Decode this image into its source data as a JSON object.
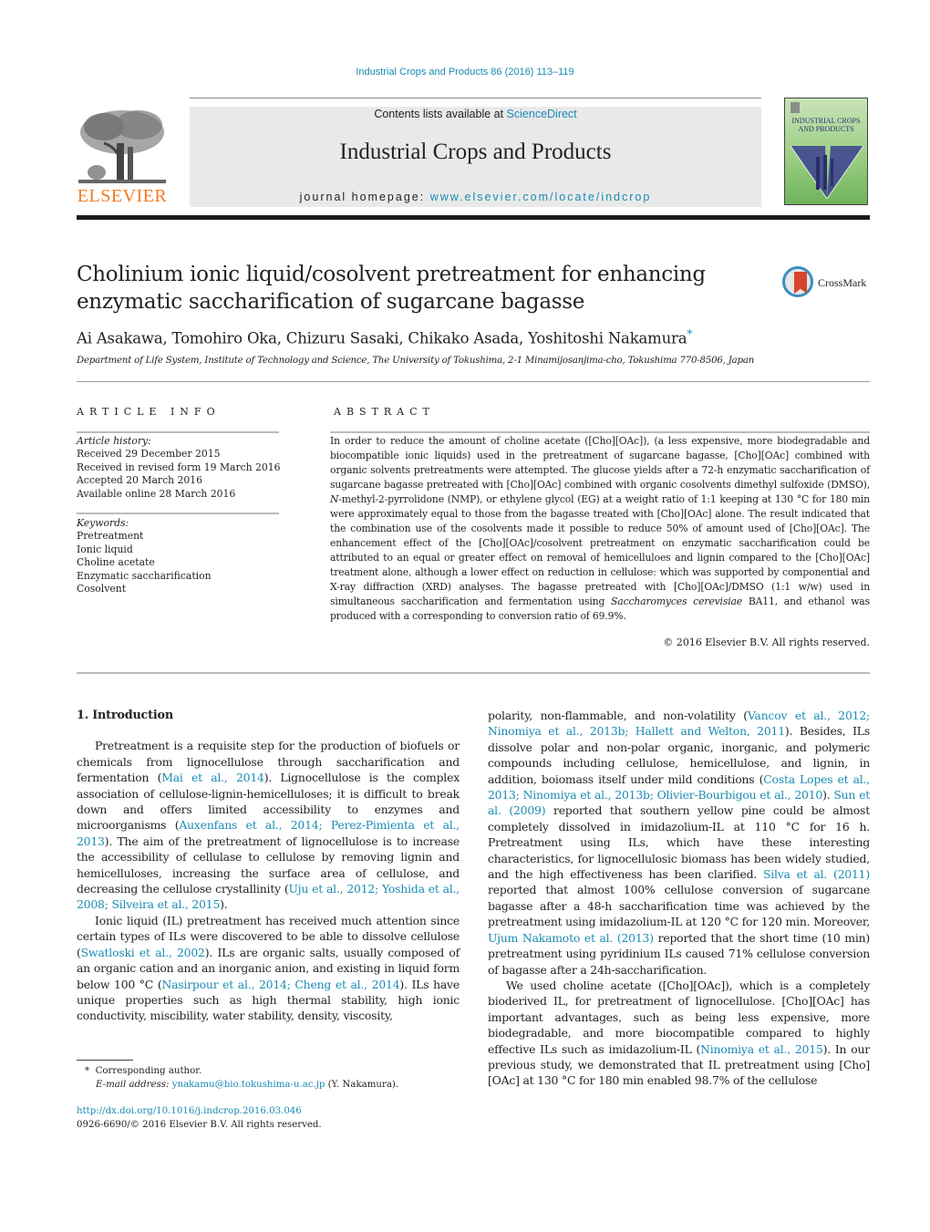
{
  "header": {
    "citation": "Industrial Crops and Products 86 (2016) 113–119",
    "contents_prefix": "Contents lists available at ",
    "contents_link": "ScienceDirect",
    "journal_title": "Industrial Crops and Products",
    "homepage_prefix": "journal homepage: ",
    "homepage_link": "www.elsevier.com/locate/indcrop",
    "publisher_logo_text": "ELSEVIER",
    "cover_title": "INDUSTRIAL CROPS AND PRODUCTS",
    "colors": {
      "link": "#1a8bb3",
      "publisher": "#f47b20",
      "masthead_bg": "#e9e9e9"
    }
  },
  "article": {
    "title": "Cholinium ionic liquid/cosolvent pretreatment for enhancing enzymatic saccharification of sugarcane bagasse",
    "crossmark_label": "CrossMark",
    "authors": "Ai Asakawa, Tomohiro Oka, Chizuru Sasaki, Chikako Asada, Yoshitoshi Nakamura",
    "corresponding_marker": "*",
    "affiliation": "Department of Life System, Institute of Technology and Science, The University of Tokushima, 2-1 Minamijosanjima-cho, Tokushima 770-8506, Japan"
  },
  "article_info": {
    "heading": "ARTICLE INFO",
    "history_label": "Article history:",
    "history": [
      "Received 29 December 2015",
      "Received in revised form 19 March 2016",
      "Accepted 20 March 2016",
      "Available online 28 March 2016"
    ],
    "keywords_label": "Keywords:",
    "keywords": [
      "Pretreatment",
      "Ionic liquid",
      "Choline acetate",
      "Enzymatic saccharification",
      "Cosolvent"
    ]
  },
  "abstract": {
    "heading": "ABSTRACT",
    "text_1": "In order to reduce the amount of choline acetate ([Cho][OAc]), (a less expensive, more biodegradable and biocompatible ionic liquids) used in the pretreatment of sugarcane bagasse, [Cho][OAc] combined with organic solvents pretreatments were attempted. The glucose yields after a 72-h enzymatic saccharification of sugarcane bagasse pretreated with [Cho][OAc] combined with organic cosolvents dimethyl sulfoxide (DMSO), ",
    "italic_1": "N",
    "text_2": "-methyl-2-pyrrolidone (NMP), or ethylene glycol (EG) at a weight ratio of 1:1 keeping at 130 °C for 180 min were approximately equal to those from the bagasse treated with [Cho][OAc] alone. The result indicated that the combination use of the cosolvents made it possible to reduce 50% of amount used of [Cho][OAc]. The enhancement effect of the [Cho][OAc]/cosolvent pretreatment on enzymatic saccharification could be attributed to an equal or greater effect on removal of hemicelluloes and lignin compared to the [Cho][OAc] treatment alone, although a lower effect on reduction in cellulose: which was supported by componential and X-ray diffraction (XRD) analyses. The bagasse pretreated with [Cho][OAc]/DMSO (1:1 w/w) used in simultaneous saccharification and fermentation using ",
    "italic_2": "Saccharomyces cerevisiae",
    "text_3": " BA11, and ethanol was produced with a corresponding to conversion ratio of 69.9%.",
    "copyright": "© 2016 Elsevier B.V. All rights reserved."
  },
  "body": {
    "section_heading": "1.  Introduction",
    "p1": [
      {
        "t": "Pretreatment is a requisite step for the production of biofuels or chemicals from lignocellulose through saccharification and fermentation ("
      },
      {
        "l": "Mai et al., 2014"
      },
      {
        "t": "). Lignocellulose is the complex association of cellulose-lignin-hemicelluloses; it is difficult to break down and offers limited accessibility to enzymes and microorganisms ("
      },
      {
        "l": "Auxenfans et al., 2014; Perez-Pimienta et al., 2013"
      },
      {
        "t": "). The aim of the pretreatment of lignocellulose is to increase the accessibility of cellulase to cellulose by removing lignin and hemicelluloses, increasing the surface area of cellulose, and decreasing the cellulose crystallinity ("
      },
      {
        "l": "Uju et al., 2012; Yoshida et al., 2008; Silveira et al., 2015"
      },
      {
        "t": ")."
      }
    ],
    "p2": [
      {
        "t": "Ionic liquid (IL) pretreatment has received much attention since certain types of ILs were discovered to be able to dissolve cellulose ("
      },
      {
        "l": "Swatloski et al., 2002"
      },
      {
        "t": "). ILs are organic salts, usually composed of an organic cation and an inorganic anion, and existing in liquid form below 100 °C ("
      },
      {
        "l": "Nasirpour et al., 2014; Cheng et al., 2014"
      },
      {
        "t": "). ILs have unique properties such as high thermal stability, high ionic conductivity, miscibility, water stability, density, viscosity, polarity, non-flammable, and non-volatility ("
      },
      {
        "l": "Vancov et al., 2012; Ninomiya et al., 2013b; Hallett and Welton, 2011"
      },
      {
        "t": "). Besides, ILs dissolve polar and non-polar organic, inorganic, and polymeric compounds including cellulose, hemicellulose, and lignin, in addition, boiomass itself under mild conditions ("
      },
      {
        "l": "Costa Lopes et al., 2013; Ninomiya et al., 2013b; Olivier-Bourbigou et al., 2010"
      },
      {
        "t": "). "
      },
      {
        "l": "Sun et al. (2009)"
      },
      {
        "t": " reported that southern yellow pine could be almost completely dissolved in imidazolium-IL at 110 °C for 16 h. Pretreatment using ILs, which have these interesting characteristics, for lignocellulosic biomass has been widely studied, and the high effectiveness has been clarified. "
      },
      {
        "l": "Silva et al. (2011)"
      },
      {
        "t": " reported that almost 100% cellulose conversion of sugarcane bagasse after a 48-h saccharification time was achieved by the pretreatment using imidazolium-IL at 120 °C for 120 min. Moreover, "
      },
      {
        "l": "Ujum Nakamoto et al. (2013)"
      },
      {
        "t": " reported that the short time (10 min) pretreatment using pyridinium ILs caused 71% cellulose conversion of bagasse after a 24h-saccharification."
      }
    ],
    "p3": [
      {
        "t": "We used choline acetate ([Cho][OAc]), which is a completely bioderived IL, for pretreatment of lignocellulose. [Cho][OAc] has important advantages, such as being less expensive, more biodegradable, and more biocompatible compared to highly effective ILs such as imidazolium-IL ("
      },
      {
        "l": "Ninomiya et al., 2015"
      },
      {
        "t": "). In our previous study, we demonstrated that IL pretreatment using [Cho][OAc] at 130 °C for 180 min enabled 98.7% of the cellulose"
      }
    ]
  },
  "footnote": {
    "marker": "*",
    "corresponding": "Corresponding author.",
    "email_label": "E-mail address:",
    "email": "ynakamu@bio.tokushima-u.ac.jp",
    "email_suffix": " (Y. Nakamura).",
    "doi": "http://dx.doi.org/10.1016/j.indcrop.2016.03.046",
    "issn_line": "0926-6690/© 2016 Elsevier B.V. All rights reserved."
  }
}
